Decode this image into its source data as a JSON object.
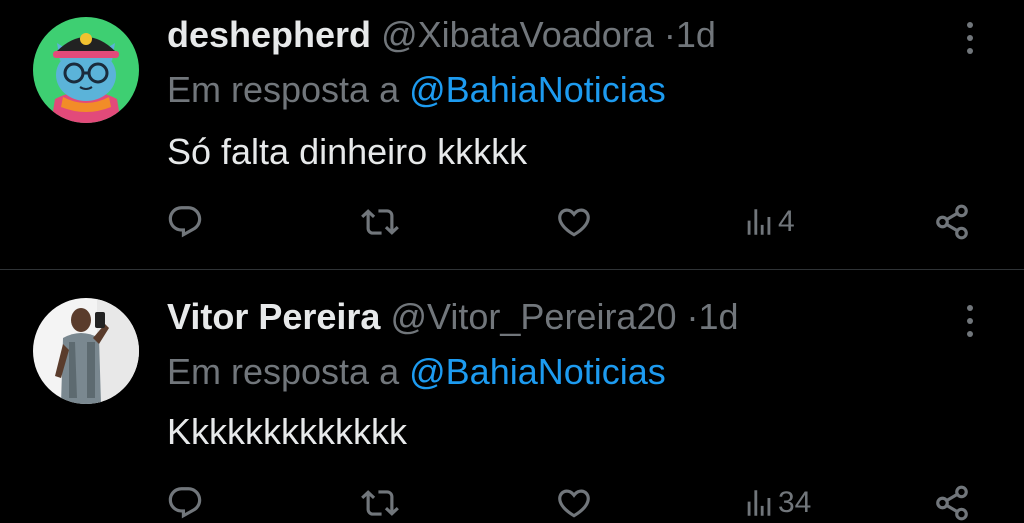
{
  "tweets": [
    {
      "name": "deshepherd",
      "handle": "@XibataVoadora",
      "dot": "·",
      "time": "1d",
      "reply_prefix": "Em resposta a",
      "reply_mention": "@BahiaNoticias",
      "text": "Só falta dinheiro kkkkk",
      "views": "4"
    },
    {
      "name": "Vitor Pereira",
      "handle": "@Vitor_Pereira20",
      "dot": "·",
      "time": "1d",
      "reply_prefix": "Em resposta a",
      "reply_mention": "@BahiaNoticias",
      "text": "Kkkkkkkkkkkkk",
      "views": "34"
    }
  ],
  "icons": [
    "reply-icon",
    "retweet-icon",
    "like-icon",
    "views-icon",
    "share-icon",
    "more-icon"
  ],
  "colors": {
    "background": "#000000",
    "text": "#e7e9ea",
    "muted": "#71767b",
    "mention": "#1d9bf0",
    "divider": "#2f3336"
  }
}
